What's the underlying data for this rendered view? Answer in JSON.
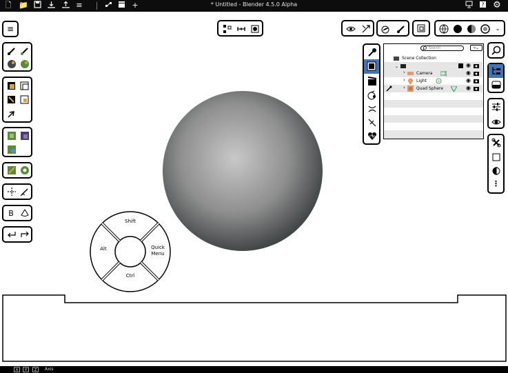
{
  "app": {
    "title": "* Untitled - Blender 4.5.0 Alpha"
  },
  "outliner": {
    "search_placeholder": "Search",
    "scene_collection": "Scene Collection",
    "items": [
      {
        "label": "Camera"
      },
      {
        "label": "Light"
      },
      {
        "label": "Quad Sphere"
      }
    ]
  },
  "pie_menu": {
    "top": "Shift",
    "left": "Alt",
    "right_line1": "Quick",
    "right_line2": "Menu",
    "bottom": "Ctrl"
  },
  "toolbar_left": {
    "text_tool": "B"
  },
  "statusbar": {
    "keys": [
      "X",
      "Y",
      "Z"
    ],
    "label": "Axis"
  },
  "colors": {
    "accent": "#4772b3",
    "topbar": "#0d0d0d",
    "row_stripe": "#e6e6e6"
  },
  "icons": [
    "new-file-icon",
    "open-folder-icon",
    "save-icon",
    "import-icon",
    "export-icon",
    "menu-icon",
    "node-icon",
    "clapper-icon",
    "plus-icon",
    "monitor-icon",
    "help-icon",
    "gear-icon"
  ]
}
